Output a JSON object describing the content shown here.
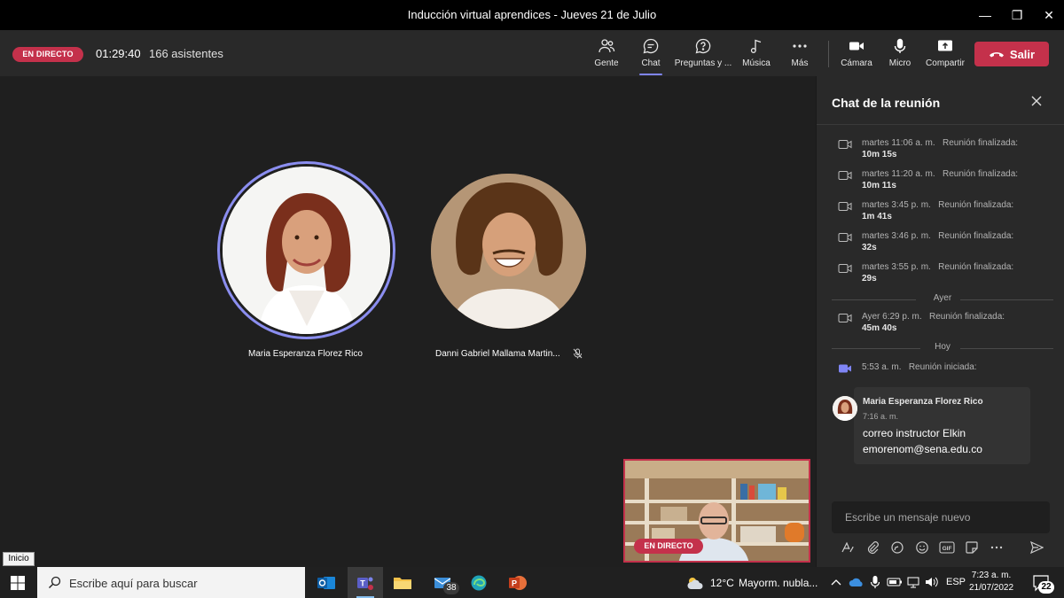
{
  "window": {
    "title": "Inducción virtual aprendices - Jueves 21 de Julio",
    "minimize_label": "—",
    "restore_label": "❐",
    "close_label": "✕"
  },
  "meeting": {
    "live_badge": "EN DIRECTO",
    "timer": "01:29:40",
    "attendees": "166 asistentes"
  },
  "toolbar": {
    "people_label": "Gente",
    "chat_label": "Chat",
    "qa_label": "Preguntas y ...",
    "music_label": "Música",
    "more_label": "Más",
    "camera_label": "Cámara",
    "mic_label": "Micro",
    "share_label": "Compartir",
    "leave_label": "Salir"
  },
  "participants": [
    {
      "name": "Maria Esperanza Florez Rico"
    },
    {
      "name": "Danni Gabriel Mallama Martin..."
    }
  ],
  "selfview": {
    "live_badge": "EN DIRECTO"
  },
  "chat": {
    "title": "Chat de la reunión",
    "events": [
      {
        "time": "martes 11:06 a. m.",
        "label": "Reunión finalizada:",
        "duration": "10m 15s"
      },
      {
        "time": "martes 11:20 a. m.",
        "label": "Reunión finalizada:",
        "duration": "10m 11s"
      },
      {
        "time": "martes 3:45 p. m.",
        "label": "Reunión finalizada:",
        "duration": "1m 41s"
      },
      {
        "time": "martes 3:46 p. m.",
        "label": "Reunión finalizada:",
        "duration": "32s"
      },
      {
        "time": "martes 3:55 p. m.",
        "label": "Reunión finalizada:",
        "duration": "29s"
      }
    ],
    "divider_yesterday": "Ayer",
    "event_yesterday": {
      "time": "Ayer 6:29 p. m.",
      "label": "Reunión finalizada:",
      "duration": "45m 40s"
    },
    "divider_today": "Hoy",
    "event_today": {
      "time": "5:53 a. m.",
      "label": "Reunión iniciada:"
    },
    "message": {
      "author": "Maria Esperanza Florez Rico",
      "time": "7:16 a. m.",
      "line1": "correo instructor Elkin",
      "line2": "emorenom@sena.edu.co"
    },
    "compose_placeholder": "Escribe un mensaje nuevo"
  },
  "tooltip": "Inicio",
  "taskbar": {
    "search_placeholder": "Escribe aquí para buscar",
    "mail_badge": "38",
    "weather_temp": "12°C",
    "weather_text": "Mayorm. nubla...",
    "language": "ESP",
    "time": "7:23 a. m.",
    "date": "21/07/2022",
    "notifications": "22"
  },
  "colors": {
    "live_red": "#c4314b",
    "accent": "#7f85f5",
    "panel": "#292929",
    "stage": "#1f1f1f"
  }
}
